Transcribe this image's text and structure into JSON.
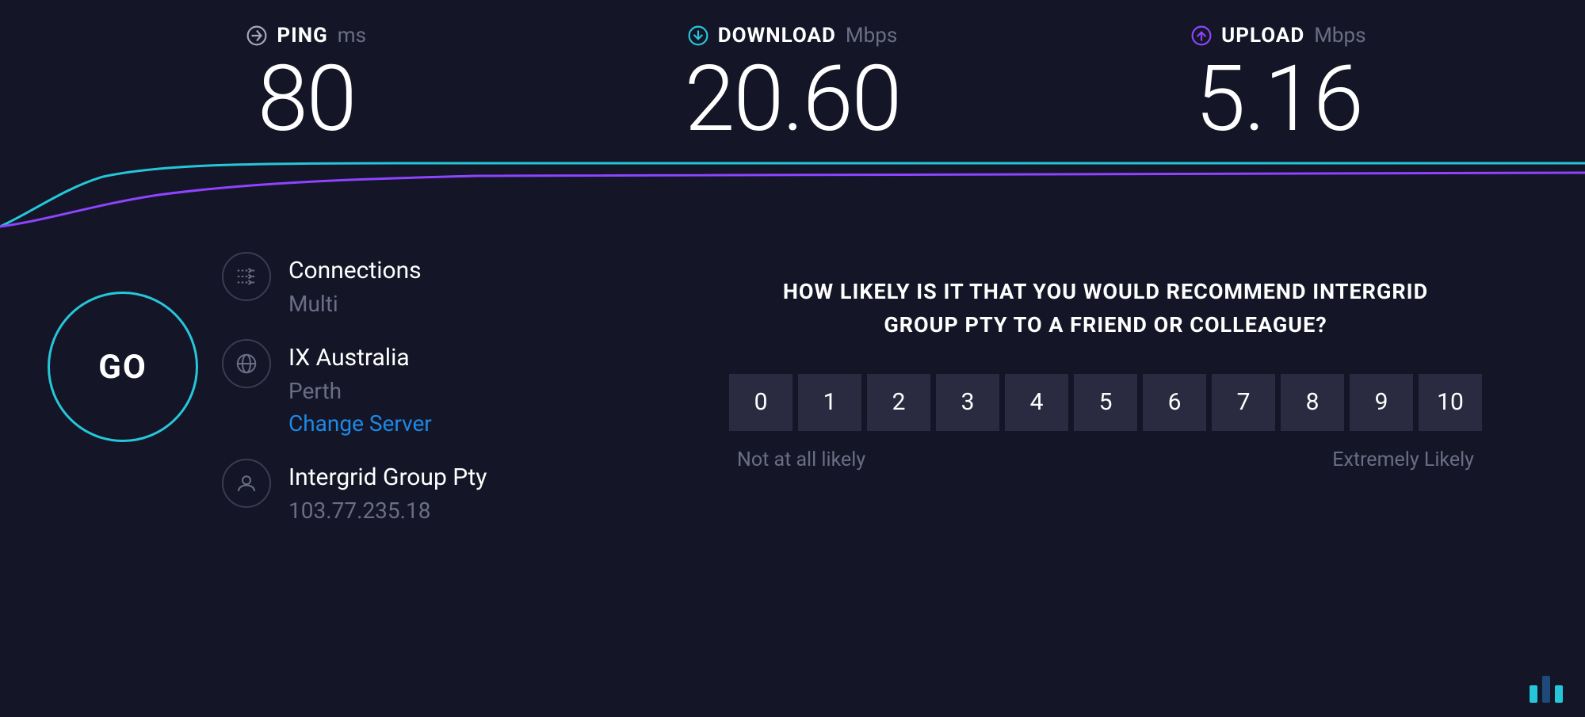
{
  "metrics": {
    "ping": {
      "label": "PING",
      "unit": "ms",
      "value": "80"
    },
    "download": {
      "label": "DOWNLOAD",
      "unit": "Mbps",
      "value": "20.60"
    },
    "upload": {
      "label": "UPLOAD",
      "unit": "Mbps",
      "value": "5.16"
    }
  },
  "go_label": "GO",
  "info": {
    "connections": {
      "title": "Connections",
      "sub": "Multi"
    },
    "server": {
      "title": "IX Australia",
      "sub": "Perth",
      "change": "Change Server"
    },
    "isp": {
      "title": "Intergrid Group Pty",
      "sub": "103.77.235.18"
    }
  },
  "survey": {
    "question": "HOW LIKELY IS IT THAT YOU WOULD RECOMMEND INTERGRID GROUP PTY TO A FRIEND OR COLLEAGUE?",
    "ratings": [
      "0",
      "1",
      "2",
      "3",
      "4",
      "5",
      "6",
      "7",
      "8",
      "9",
      "10"
    ],
    "low_label": "Not at all likely",
    "high_label": "Extremely Likely"
  },
  "colors": {
    "ping": "#a6a8b8",
    "download": "#26c6da",
    "upload": "#8e44ff"
  }
}
